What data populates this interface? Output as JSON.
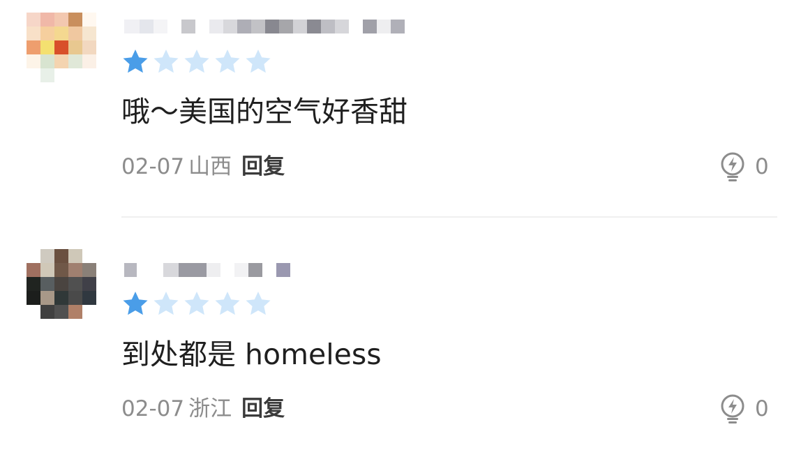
{
  "colors": {
    "star_filled": "#4a9de8",
    "star_empty": "#cfe6fa",
    "text": "#1f1f1f",
    "meta": "#8c8c8c",
    "reply": "#3a3a3a"
  },
  "comments": [
    {
      "rating": 1,
      "max_rating": 5,
      "text": "哦～美国的空气好香甜",
      "date": "02-07",
      "location": "山西",
      "reply_label": "回复",
      "like_icon": "lightbulb-icon",
      "like_count": "0"
    },
    {
      "rating": 1,
      "max_rating": 5,
      "text": "到处都是 homeless",
      "date": "02-07",
      "location": "浙江",
      "reply_label": "回复",
      "like_icon": "lightbulb-icon",
      "like_count": "0"
    }
  ]
}
